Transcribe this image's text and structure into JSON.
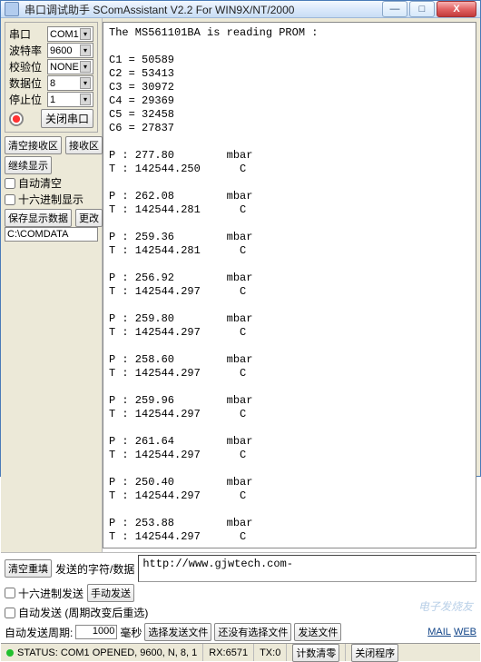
{
  "title": "串口调试助手 SComAssistant V2.2 For WIN9X/NT/2000",
  "win": {
    "min": "—",
    "max": "□",
    "close": "X"
  },
  "port_group": {
    "title": "串口",
    "rows": {
      "port": {
        "label": "串口",
        "value": "COM1"
      },
      "baud": {
        "label": "波特率",
        "value": "9600"
      },
      "parity": {
        "label": "校验位",
        "value": "NONE"
      },
      "data": {
        "label": "数据位",
        "value": "8"
      },
      "stop": {
        "label": "停止位",
        "value": "1"
      }
    },
    "close_btn": "关闭串口"
  },
  "rx": {
    "clear": "清空接收区",
    "recv_area": "接收区",
    "continue": "继续显示",
    "auto_clear": "自动清空",
    "hex_display": "十六进制显示",
    "save_data": "保存显示数据",
    "change": "更改",
    "path": "C:\\COMDATA"
  },
  "console": "The MS561101BA is reading PROM :\n\nC1 = 50589\nC2 = 53413\nC3 = 30972\nC4 = 29369\nC5 = 32458\nC6 = 27837\n\nP : 277.80        mbar\nT : 142544.250      C\n\nP : 262.08        mbar\nT : 142544.281      C\n\nP : 259.36        mbar\nT : 142544.281      C\n\nP : 256.92        mbar\nT : 142544.297      C\n\nP : 259.80        mbar\nT : 142544.297      C\n\nP : 258.60        mbar\nT : 142544.297      C\n\nP : 259.96        mbar\nT : 142544.297      C\n\nP : 261.64        mbar\nT : 142544.297      C\n\nP : 250.40        mbar\nT : 142544.297      C\n\nP : 253.88        mbar\nT : 142544.297      C\n",
  "tx": {
    "clear_fill": "清空重填",
    "send_label": "发送的字符/数据",
    "send_value": "http://www.gjwtech.com-",
    "hex_send": "十六进制发送",
    "manual_send": "手动发送",
    "auto_send": "自动发送 (周期改变后重选)",
    "period_label": "自动发送周期:",
    "period_value": "1000",
    "period_unit": "毫秒",
    "choose_file": "选择发送文件",
    "no_file": "还没有选择文件",
    "send_file": "发送文件",
    "mail": "MAIL",
    "web": "WEB"
  },
  "status": {
    "text": "STATUS: COM1 OPENED, 9600, N, 8, 1",
    "rx_label": "RX:6571",
    "tx_label": "TX:0",
    "reset": "计数清零",
    "exit": "关闭程序"
  },
  "watermark": "电子发烧友"
}
